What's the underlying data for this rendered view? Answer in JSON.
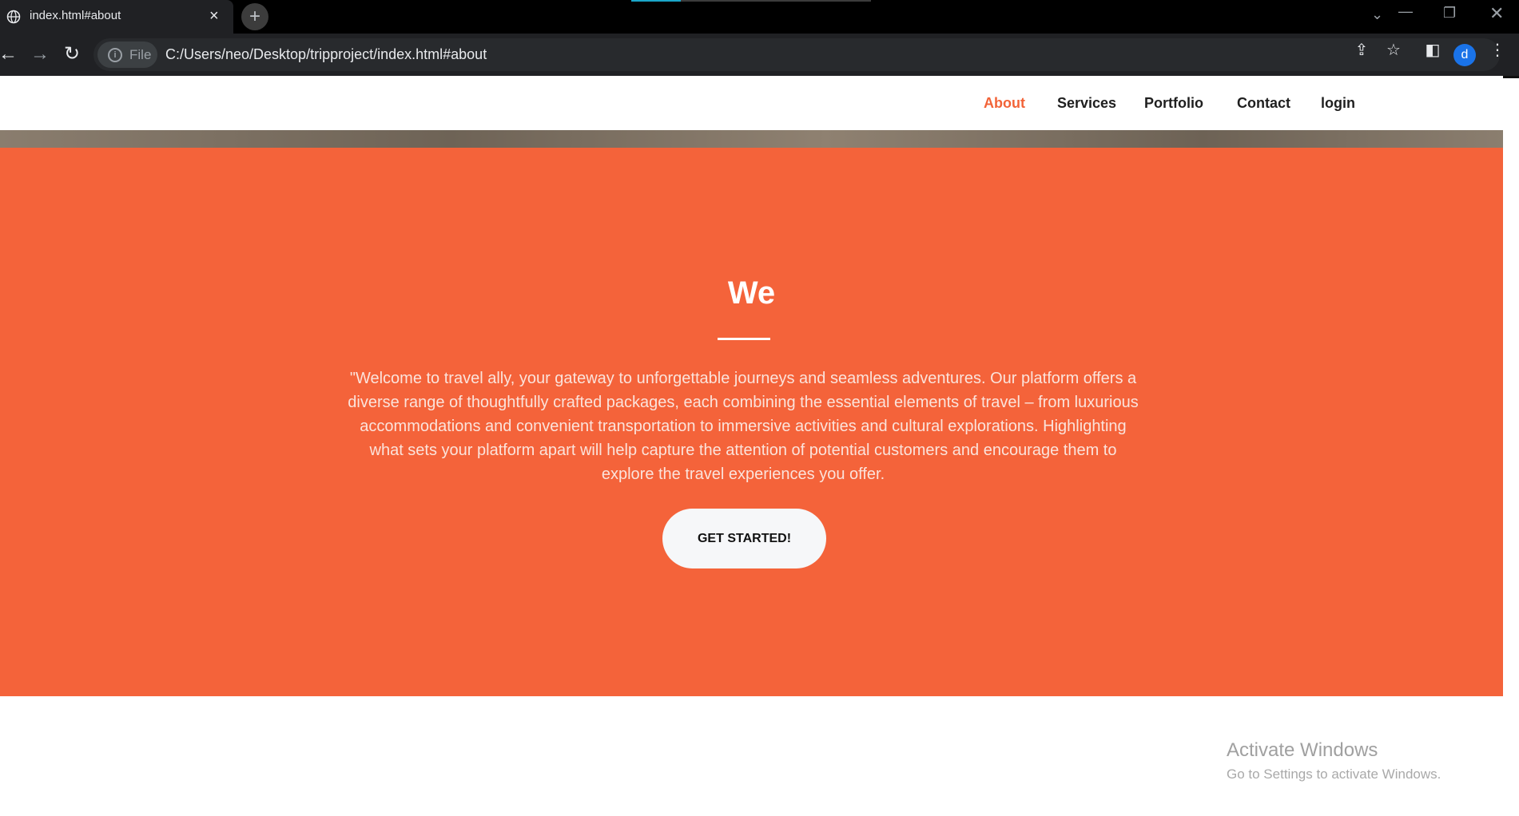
{
  "browser": {
    "tab_title": "index.html#about",
    "tab_close": "×",
    "new_tab": "+",
    "security_chip": "File",
    "url": "C:/Users/neo/Desktop/tripproject/index.html#about",
    "profile_initial": "d",
    "accent_color": "#1a73e8"
  },
  "navbar": {
    "links": [
      {
        "label": "About",
        "active": true
      },
      {
        "label": "Services",
        "active": false
      },
      {
        "label": "Portfolio",
        "active": false
      },
      {
        "label": "Contact",
        "active": false
      },
      {
        "label": "login",
        "active": false
      }
    ],
    "active_color": "#f26338"
  },
  "hero": {
    "heading": "We",
    "body": "\"Welcome to travel ally, your gateway to unforgettable journeys and seamless adventures. Our platform offers a diverse range of thoughtfully crafted packages, each combining the essential elements of travel – from luxurious accommodations and convenient transportation to immersive activities and cultural explorations. Highlighting what sets your platform apart will help capture the attention of potential customers and encourage them to explore the travel experiences you offer.",
    "cta_label": "GET STARTED!",
    "background_color": "#f4633a"
  },
  "watermark": {
    "title": "Activate Windows",
    "subtitle": "Go to Settings to activate Windows."
  }
}
